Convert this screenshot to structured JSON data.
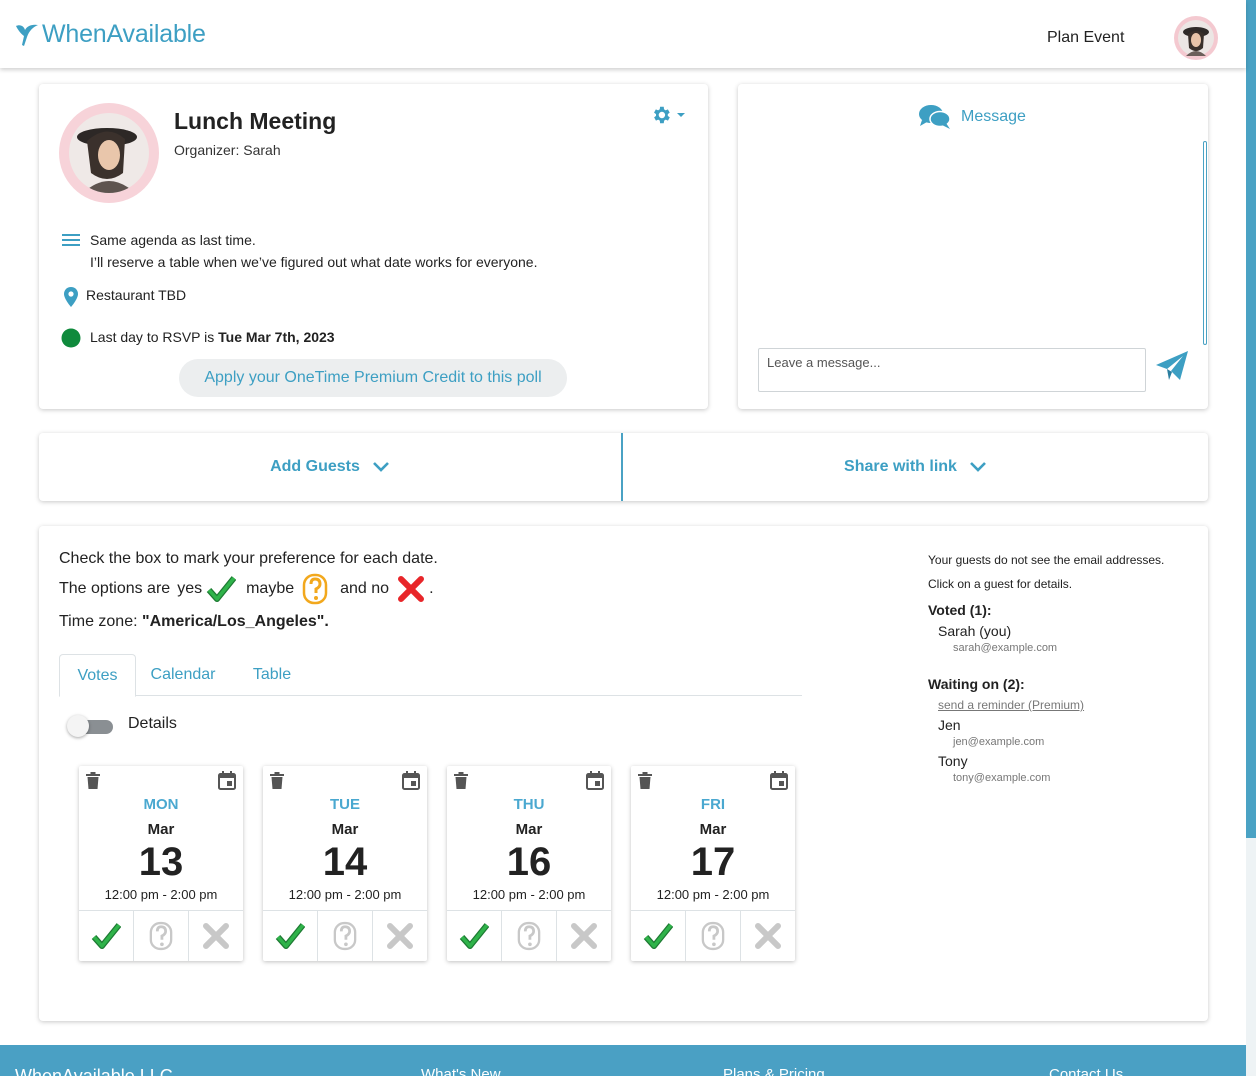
{
  "header": {
    "brand": "WhenAvailable",
    "plan_event": "Plan Event"
  },
  "event": {
    "title": "Lunch Meeting",
    "organizer": "Organizer: Sarah",
    "description_line1": "Same agenda as last time.",
    "description_line2": "I’ll reserve a table when we’ve figured out what date works for everyone.",
    "location": "Restaurant TBD",
    "rsvp_prefix": "Last day to RSVP is ",
    "rsvp_date": "Tue Mar 7th, 2023",
    "premium_button": "Apply your OneTime Premium Credit to this poll"
  },
  "message": {
    "title": "Message",
    "placeholder": "Leave a message..."
  },
  "actions": {
    "add_guests": "Add Guests",
    "share_link": "Share with link"
  },
  "poll": {
    "instructions": "Check the box to mark your preference for each date.",
    "options_prefix": "The options are",
    "yes": "yes",
    "maybe": "maybe",
    "and_no": "and no",
    "period": ".",
    "timezone_prefix": "Time zone: ",
    "timezone": "\"America/Los_Angeles\".",
    "tabs": [
      "Votes",
      "Calendar",
      "Table"
    ],
    "details_label": "Details",
    "dates": [
      {
        "dow": "MON",
        "month": "Mar",
        "day": "13",
        "time": "12:00 pm - 2:00 pm"
      },
      {
        "dow": "TUE",
        "month": "Mar",
        "day": "14",
        "time": "12:00 pm - 2:00 pm"
      },
      {
        "dow": "THU",
        "month": "Mar",
        "day": "16",
        "time": "12:00 pm - 2:00 pm"
      },
      {
        "dow": "FRI",
        "month": "Mar",
        "day": "17",
        "time": "12:00 pm - 2:00 pm"
      }
    ]
  },
  "guests": {
    "note1": "Your guests do not see the email addresses.",
    "note2": "Click on a guest for details.",
    "voted_head": "Voted (1):",
    "voted": [
      {
        "name": "Sarah (you)",
        "email": "sarah@example.com"
      }
    ],
    "waiting_head": "Waiting on (2):",
    "reminder": "send a reminder (Premium)",
    "waiting": [
      {
        "name": "Jen",
        "email": "jen@example.com"
      },
      {
        "name": "Tony",
        "email": "tony@example.com"
      }
    ]
  },
  "footer": {
    "company": "WhenAvailable LLC",
    "whats_new": "What's New",
    "plans": "Plans & Pricing",
    "contact": "Contact Us"
  },
  "colors": {
    "brand": "#3d9fc3",
    "yes": "#2fb34a",
    "maybe": "#f2a81d",
    "no": "#e8262a",
    "rsvp_dot": "#0f8a3c"
  }
}
